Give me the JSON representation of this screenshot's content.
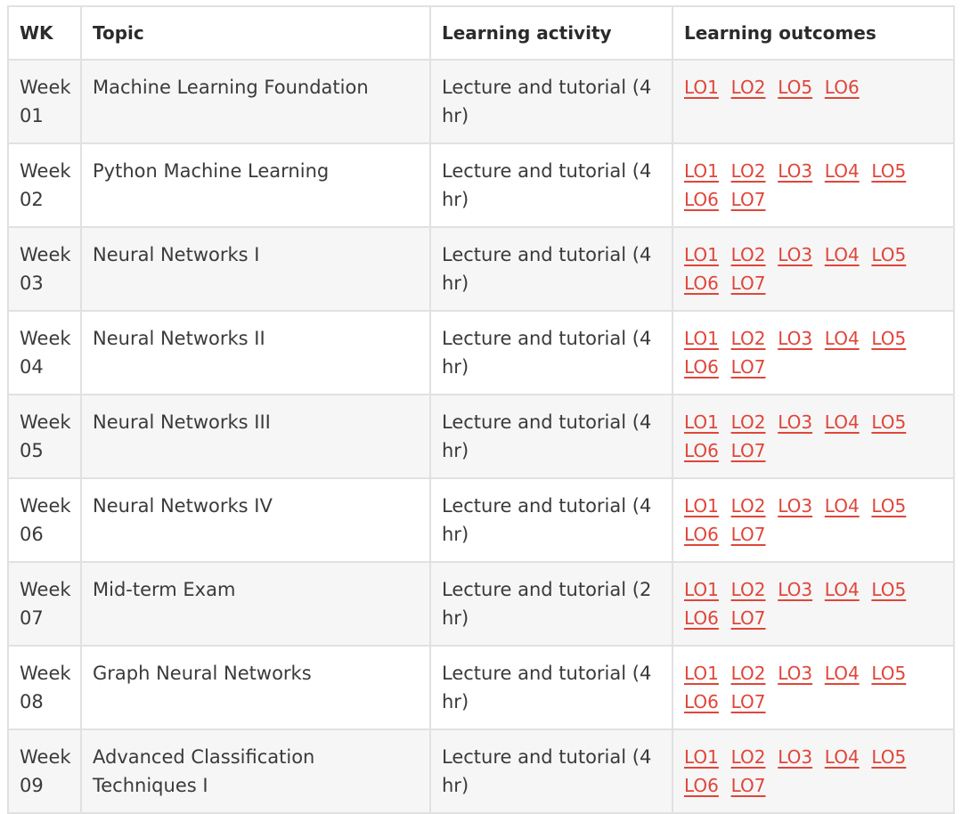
{
  "table": {
    "headers": [
      "WK",
      "Topic",
      "Learning activity",
      "Learning outcomes"
    ],
    "rows": [
      {
        "wk": "Week 01",
        "topic": "Machine Learning Foundation",
        "activity": "Lecture and tutorial (4 hr)",
        "outcomes": [
          "LO1",
          "LO2",
          "LO5",
          "LO6"
        ]
      },
      {
        "wk": "Week 02",
        "topic": "Python Machine Learning",
        "activity": "Lecture and tutorial (4 hr)",
        "outcomes": [
          "LO1",
          "LO2",
          "LO3",
          "LO4",
          "LO5",
          "LO6",
          "LO7"
        ]
      },
      {
        "wk": "Week 03",
        "topic": "Neural Networks I",
        "activity": "Lecture and tutorial (4 hr)",
        "outcomes": [
          "LO1",
          "LO2",
          "LO3",
          "LO4",
          "LO5",
          "LO6",
          "LO7"
        ]
      },
      {
        "wk": "Week 04",
        "topic": "Neural Networks II",
        "activity": "Lecture and tutorial (4 hr)",
        "outcomes": [
          "LO1",
          "LO2",
          "LO3",
          "LO4",
          "LO5",
          "LO6",
          "LO7"
        ]
      },
      {
        "wk": "Week 05",
        "topic": "Neural Networks III",
        "activity": "Lecture and tutorial (4 hr)",
        "outcomes": [
          "LO1",
          "LO2",
          "LO3",
          "LO4",
          "LO5",
          "LO6",
          "LO7"
        ]
      },
      {
        "wk": "Week 06",
        "topic": "Neural Networks IV",
        "activity": "Lecture and tutorial (4 hr)",
        "outcomes": [
          "LO1",
          "LO2",
          "LO3",
          "LO4",
          "LO5",
          "LO6",
          "LO7"
        ]
      },
      {
        "wk": "Week 07",
        "topic": "Mid-term Exam",
        "activity": "Lecture and tutorial (2 hr)",
        "outcomes": [
          "LO1",
          "LO2",
          "LO3",
          "LO4",
          "LO5",
          "LO6",
          "LO7"
        ]
      },
      {
        "wk": "Week 08",
        "topic": "Graph Neural Networks",
        "activity": "Lecture and tutorial (4 hr)",
        "outcomes": [
          "LO1",
          "LO2",
          "LO3",
          "LO4",
          "LO5",
          "LO6",
          "LO7"
        ]
      },
      {
        "wk": "Week 09",
        "topic": "Advanced Classification Techniques I",
        "activity": "Lecture and tutorial (4 hr)",
        "outcomes": [
          "LO1",
          "LO2",
          "LO3",
          "LO4",
          "LO5",
          "LO6",
          "LO7"
        ]
      }
    ]
  },
  "colors": {
    "link": "#e0453a",
    "border": "#e1e1e1",
    "stripe": "#f6f6f6"
  }
}
